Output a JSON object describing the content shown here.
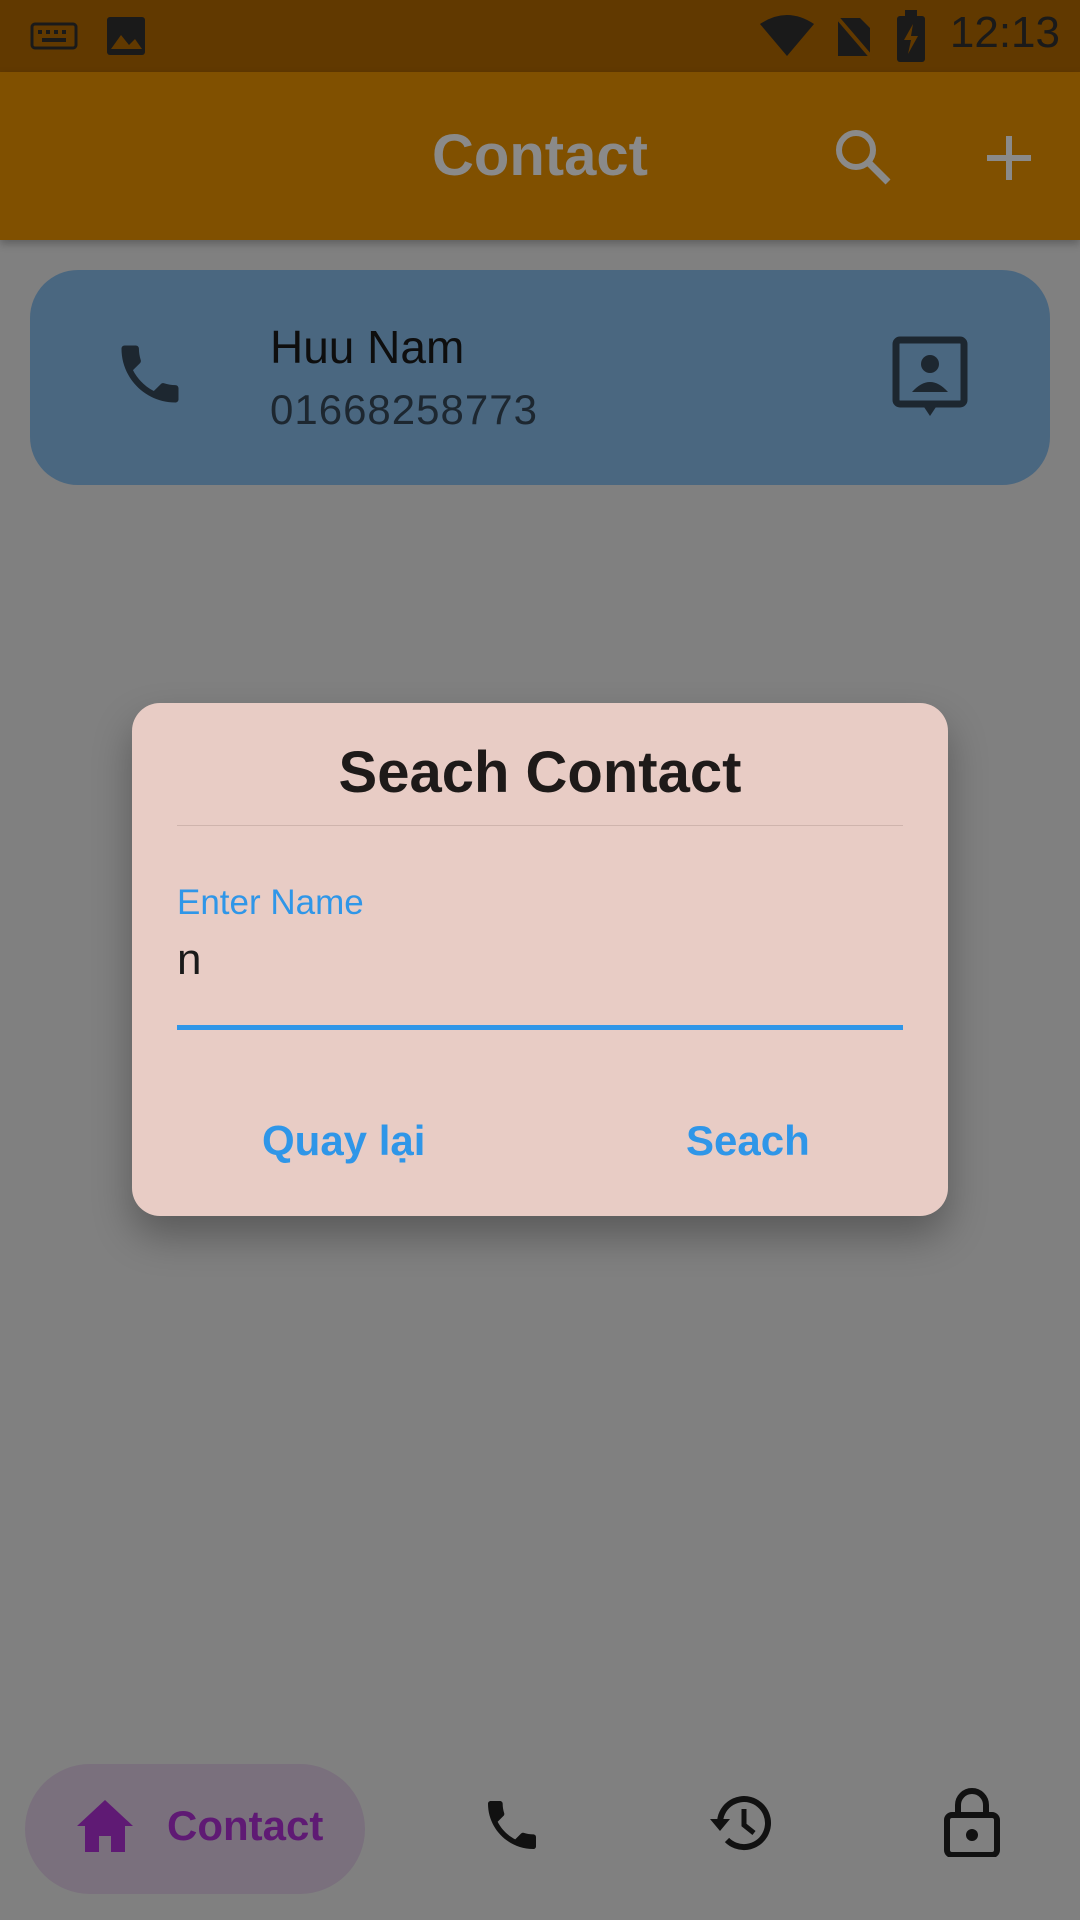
{
  "status_bar": {
    "time": "12:13",
    "icons": [
      "keyboard-icon",
      "image-icon",
      "wifi-icon",
      "no-sim-icon",
      "battery-charging-icon"
    ]
  },
  "app_bar": {
    "title": "Contact",
    "actions": [
      "search-icon",
      "add-icon"
    ]
  },
  "contact_list": [
    {
      "name": "Huu Nam",
      "phone": "01668258773",
      "leading_icon": "phone-icon",
      "trailing_icon": "contact-card-icon"
    }
  ],
  "dialog": {
    "title": "Seach Contact",
    "field_label": "Enter Name",
    "field_value": "n",
    "cancel_label": "Quay lại",
    "confirm_label": "Seach"
  },
  "bottom_nav": {
    "items": [
      {
        "label": "Contact",
        "icon": "home-icon",
        "active": true
      },
      {
        "label": "",
        "icon": "phone-icon",
        "active": false
      },
      {
        "label": "",
        "icon": "history-icon",
        "active": false
      },
      {
        "label": "",
        "icon": "lock-icon",
        "active": false
      }
    ]
  },
  "colors": {
    "app_bar": "#805000",
    "card": "#4a6780",
    "dialog": "#e8ccc5",
    "accent": "#2f96e8",
    "nav_active": "#5f1a74"
  }
}
